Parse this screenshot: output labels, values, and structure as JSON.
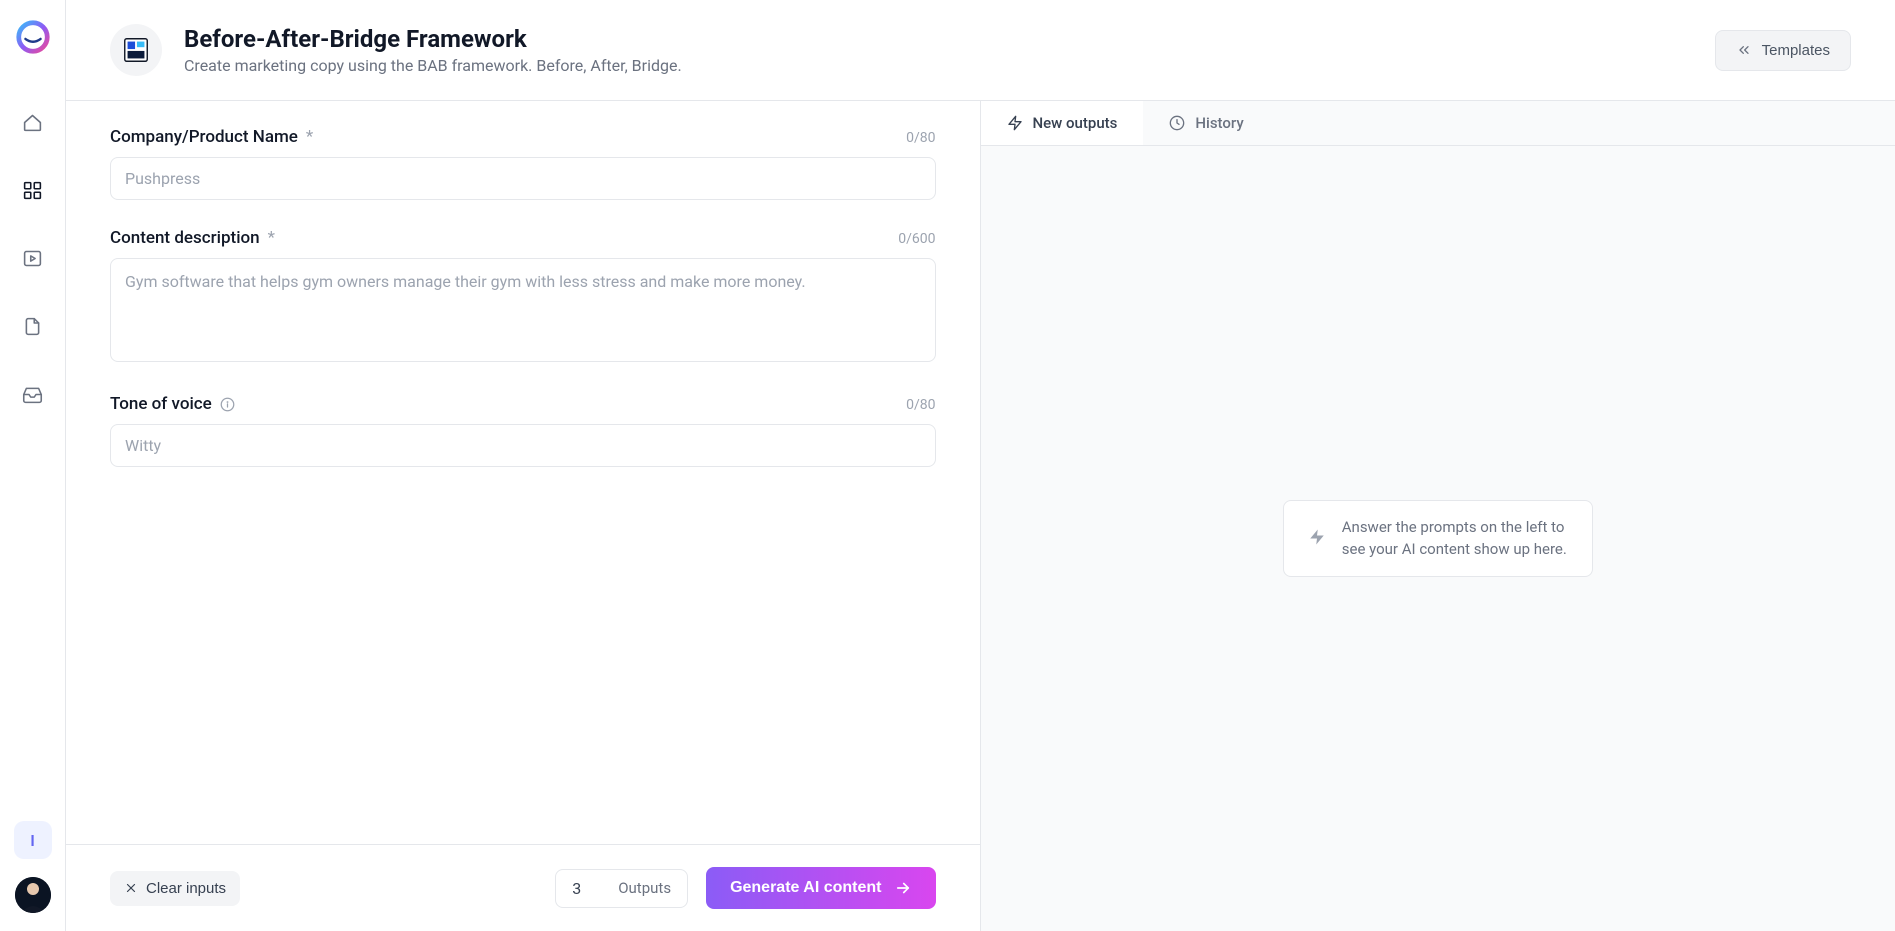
{
  "colors": {
    "primary_gradient_from": "#8b5cf6",
    "primary_gradient_to": "#d946ef",
    "border": "#e5e7eb"
  },
  "sidebar": {
    "logo": "jarvis-logo",
    "items": [
      "home-icon",
      "templates-icon",
      "play-icon",
      "document-icon",
      "inbox-icon"
    ],
    "footer_badge": "I",
    "avatar": "user-avatar"
  },
  "header": {
    "title": "Before-After-Bridge Framework",
    "subtitle": "Create marketing copy using the BAB framework. Before, After, Bridge.",
    "templates_button": "Templates"
  },
  "form": {
    "fields": [
      {
        "label": "Company/Product Name",
        "required": true,
        "counter": "0/80",
        "placeholder": "Pushpress",
        "value": "",
        "type": "text"
      },
      {
        "label": "Content description",
        "required": true,
        "counter": "0/600",
        "placeholder": "Gym software that helps gym owners manage their gym with less stress and make more money.",
        "value": "",
        "type": "textarea"
      },
      {
        "label": "Tone of voice",
        "required": false,
        "info": true,
        "counter": "0/80",
        "placeholder": "Witty",
        "value": "",
        "type": "text"
      }
    ],
    "footer": {
      "clear": "Clear inputs",
      "outputs_value": "3",
      "outputs_label": "Outputs",
      "generate": "Generate AI content"
    }
  },
  "output": {
    "tabs": [
      {
        "label": "New outputs",
        "active": true,
        "icon": "zap-icon"
      },
      {
        "label": "History",
        "active": false,
        "icon": "clock-icon"
      }
    ],
    "empty_message": "Answer the prompts on the left to see your AI content show up here."
  }
}
